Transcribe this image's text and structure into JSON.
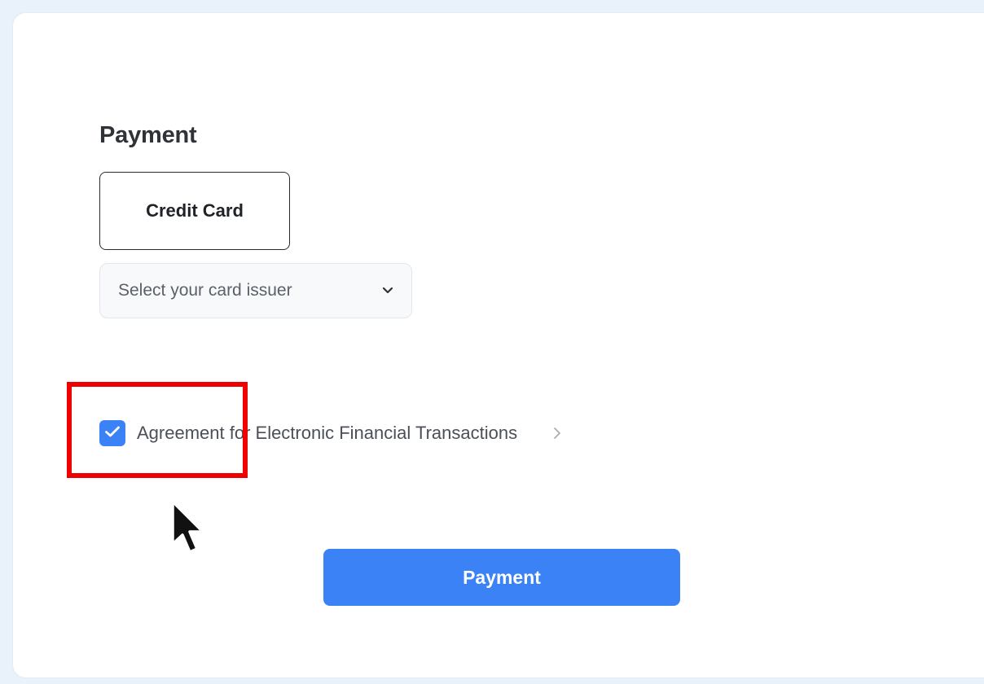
{
  "payment": {
    "title": "Payment",
    "method_tab_label": "Credit Card",
    "card_issuer_select": {
      "placeholder": "Select your card issuer"
    },
    "agreement": {
      "label": "Agreement for Electronic Financial Transactions",
      "checked": true
    },
    "submit_label": "Payment"
  },
  "colors": {
    "primary": "#3b82f6",
    "highlight": "#ee0000",
    "page_background": "#e9f1fb"
  },
  "icons": {
    "select_chevron": "chevron-down-icon",
    "checkbox_mark": "check-icon",
    "agreement_link": "chevron-right-icon",
    "pointer": "mouse-cursor-icon"
  }
}
